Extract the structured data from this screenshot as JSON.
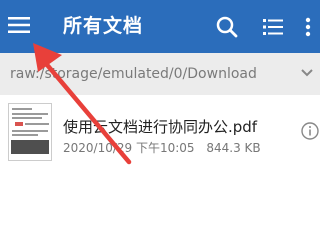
{
  "appbar": {
    "title": "所有文档",
    "icons": [
      "hamburger-menu-icon",
      "search-icon",
      "list-view-icon",
      "more-vert-icon"
    ],
    "background_color": "#2b6dbb"
  },
  "pathbar": {
    "path": "raw:/storage/emulated/0/Download",
    "icon": "chevron-down-icon"
  },
  "files": [
    {
      "name": "使用云文档进行协同办公.pdf",
      "date": "2020/10/29 下午10:05",
      "size": "844.3 KB",
      "icon": "info-icon"
    }
  ],
  "annotation": {
    "type": "arrow",
    "color": "#e8403a",
    "points_to": "hamburger-menu-icon"
  }
}
